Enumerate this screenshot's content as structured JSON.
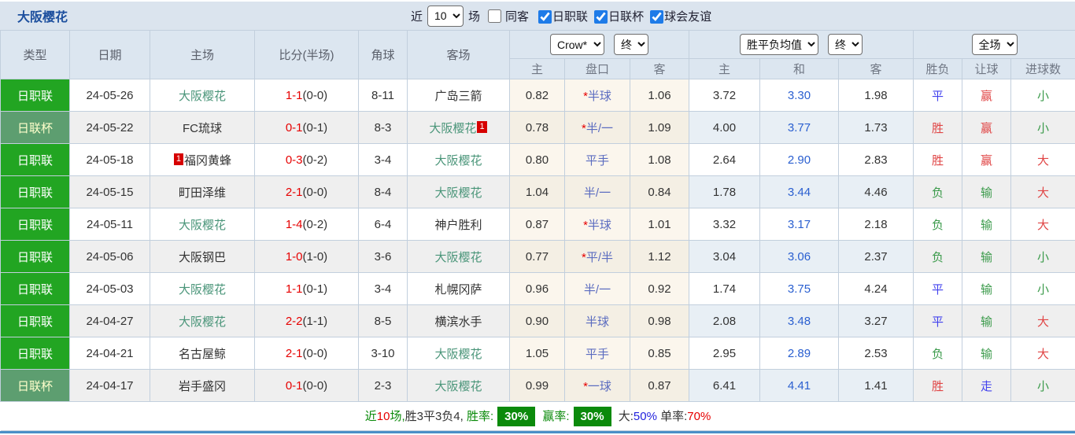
{
  "title": "大阪樱花",
  "topbar": {
    "recent_label": "近",
    "recent_value": "10",
    "matches_label": "场",
    "same_venue_label": "同客",
    "same_venue_checked": false,
    "filters": [
      {
        "label": "日职联",
        "checked": true
      },
      {
        "label": "日联杯",
        "checked": true
      },
      {
        "label": "球会友谊",
        "checked": true
      }
    ]
  },
  "header": {
    "cols": [
      "类型",
      "日期",
      "主场",
      "比分(半场)",
      "角球",
      "客场"
    ],
    "odds_select": "Crow*",
    "odds_time_select": "终",
    "odds_sub": [
      "主",
      "盘口",
      "客"
    ],
    "avg_select": "胜平负均值",
    "avg_time_select": "终",
    "avg_sub": [
      "主",
      "和",
      "客"
    ],
    "period_select": "全场",
    "result_sub": [
      "胜负",
      "让球",
      "进球数"
    ]
  },
  "colors": {
    "league_badge": "#22a522",
    "cup_badge": "#5d9e70",
    "self_team": "#4a9579",
    "score_red": "#e60000",
    "handicap_blue": "#5b6cc0",
    "avg_draw_blue": "#2a5fd0",
    "win_red": "#e04545",
    "draw_blue": "#4343ee",
    "lose_green": "#3a9a4a",
    "summary_box_green": "#0b8a0b",
    "bottom_line_blue": "#4a8fc7"
  },
  "rows": [
    {
      "league": "日职联",
      "cup": false,
      "date": "24-05-26",
      "home": {
        "name": "大阪樱花",
        "self": true,
        "badge": "",
        "badge_pos": ""
      },
      "score": "1-1",
      "half": "(0-0)",
      "corner": "8-11",
      "away": {
        "name": "广岛三箭",
        "self": false,
        "badge": "",
        "badge_pos": ""
      },
      "odds": {
        "home": "0.82",
        "star": true,
        "hcap": "半球",
        "away": "1.06"
      },
      "avg": [
        "3.72",
        "3.30",
        "1.98"
      ],
      "res": {
        "t": "平",
        "c": "blue"
      },
      "let": {
        "t": "赢",
        "c": "red"
      },
      "goal": {
        "t": "小",
        "c": "green"
      }
    },
    {
      "league": "日联杯",
      "cup": true,
      "date": "24-05-22",
      "home": {
        "name": "FC琉球",
        "self": false,
        "badge": "",
        "badge_pos": ""
      },
      "score": "0-1",
      "half": "(0-1)",
      "corner": "8-3",
      "away": {
        "name": "大阪樱花",
        "self": true,
        "badge": "1",
        "badge_pos": "post"
      },
      "odds": {
        "home": "0.78",
        "star": true,
        "hcap": "半/一",
        "away": "1.09"
      },
      "avg": [
        "4.00",
        "3.77",
        "1.73"
      ],
      "res": {
        "t": "胜",
        "c": "red"
      },
      "let": {
        "t": "赢",
        "c": "red"
      },
      "goal": {
        "t": "小",
        "c": "green"
      }
    },
    {
      "league": "日职联",
      "cup": false,
      "date": "24-05-18",
      "home": {
        "name": "福冈黄蜂",
        "self": false,
        "badge": "1",
        "badge_pos": "pre"
      },
      "score": "0-3",
      "half": "(0-2)",
      "corner": "3-4",
      "away": {
        "name": "大阪樱花",
        "self": true,
        "badge": "",
        "badge_pos": ""
      },
      "odds": {
        "home": "0.80",
        "star": false,
        "hcap": "平手",
        "away": "1.08"
      },
      "avg": [
        "2.64",
        "2.90",
        "2.83"
      ],
      "res": {
        "t": "胜",
        "c": "red"
      },
      "let": {
        "t": "赢",
        "c": "red"
      },
      "goal": {
        "t": "大",
        "c": "red"
      }
    },
    {
      "league": "日职联",
      "cup": false,
      "date": "24-05-15",
      "home": {
        "name": "町田泽维",
        "self": false,
        "badge": "",
        "badge_pos": ""
      },
      "score": "2-1",
      "half": "(0-0)",
      "corner": "8-4",
      "away": {
        "name": "大阪樱花",
        "self": true,
        "badge": "",
        "badge_pos": ""
      },
      "odds": {
        "home": "1.04",
        "star": false,
        "hcap": "半/一",
        "away": "0.84"
      },
      "avg": [
        "1.78",
        "3.44",
        "4.46"
      ],
      "res": {
        "t": "负",
        "c": "green"
      },
      "let": {
        "t": "输",
        "c": "green"
      },
      "goal": {
        "t": "大",
        "c": "red"
      }
    },
    {
      "league": "日职联",
      "cup": false,
      "date": "24-05-11",
      "home": {
        "name": "大阪樱花",
        "self": true,
        "badge": "",
        "badge_pos": ""
      },
      "score": "1-4",
      "half": "(0-2)",
      "corner": "6-4",
      "away": {
        "name": "神户胜利",
        "self": false,
        "badge": "",
        "badge_pos": ""
      },
      "odds": {
        "home": "0.87",
        "star": true,
        "hcap": "半球",
        "away": "1.01"
      },
      "avg": [
        "3.32",
        "3.17",
        "2.18"
      ],
      "res": {
        "t": "负",
        "c": "green"
      },
      "let": {
        "t": "输",
        "c": "green"
      },
      "goal": {
        "t": "大",
        "c": "red"
      }
    },
    {
      "league": "日职联",
      "cup": false,
      "date": "24-05-06",
      "home": {
        "name": "大阪钢巴",
        "self": false,
        "badge": "",
        "badge_pos": ""
      },
      "score": "1-0",
      "half": "(1-0)",
      "corner": "3-6",
      "away": {
        "name": "大阪樱花",
        "self": true,
        "badge": "",
        "badge_pos": ""
      },
      "odds": {
        "home": "0.77",
        "star": true,
        "hcap": "平/半",
        "away": "1.12"
      },
      "avg": [
        "3.04",
        "3.06",
        "2.37"
      ],
      "res": {
        "t": "负",
        "c": "green"
      },
      "let": {
        "t": "输",
        "c": "green"
      },
      "goal": {
        "t": "小",
        "c": "green"
      }
    },
    {
      "league": "日职联",
      "cup": false,
      "date": "24-05-03",
      "home": {
        "name": "大阪樱花",
        "self": true,
        "badge": "",
        "badge_pos": ""
      },
      "score": "1-1",
      "half": "(0-1)",
      "corner": "3-4",
      "away": {
        "name": "札幌冈萨",
        "self": false,
        "badge": "",
        "badge_pos": ""
      },
      "odds": {
        "home": "0.96",
        "star": false,
        "hcap": "半/一",
        "away": "0.92"
      },
      "avg": [
        "1.74",
        "3.75",
        "4.24"
      ],
      "res": {
        "t": "平",
        "c": "blue"
      },
      "let": {
        "t": "输",
        "c": "green"
      },
      "goal": {
        "t": "小",
        "c": "green"
      }
    },
    {
      "league": "日职联",
      "cup": false,
      "date": "24-04-27",
      "home": {
        "name": "大阪樱花",
        "self": true,
        "badge": "",
        "badge_pos": ""
      },
      "score": "2-2",
      "half": "(1-1)",
      "corner": "8-5",
      "away": {
        "name": "横滨水手",
        "self": false,
        "badge": "",
        "badge_pos": ""
      },
      "odds": {
        "home": "0.90",
        "star": false,
        "hcap": "半球",
        "away": "0.98"
      },
      "avg": [
        "2.08",
        "3.48",
        "3.27"
      ],
      "res": {
        "t": "平",
        "c": "blue"
      },
      "let": {
        "t": "输",
        "c": "green"
      },
      "goal": {
        "t": "大",
        "c": "red"
      }
    },
    {
      "league": "日职联",
      "cup": false,
      "date": "24-04-21",
      "home": {
        "name": "名古屋鲸",
        "self": false,
        "badge": "",
        "badge_pos": ""
      },
      "score": "2-1",
      "half": "(0-0)",
      "corner": "3-10",
      "away": {
        "name": "大阪樱花",
        "self": true,
        "badge": "",
        "badge_pos": ""
      },
      "odds": {
        "home": "1.05",
        "star": false,
        "hcap": "平手",
        "away": "0.85"
      },
      "avg": [
        "2.95",
        "2.89",
        "2.53"
      ],
      "res": {
        "t": "负",
        "c": "green"
      },
      "let": {
        "t": "输",
        "c": "green"
      },
      "goal": {
        "t": "大",
        "c": "red"
      }
    },
    {
      "league": "日联杯",
      "cup": true,
      "date": "24-04-17",
      "home": {
        "name": "岩手盛冈",
        "self": false,
        "badge": "",
        "badge_pos": ""
      },
      "score": "0-1",
      "half": "(0-0)",
      "corner": "2-3",
      "away": {
        "name": "大阪樱花",
        "self": true,
        "badge": "",
        "badge_pos": ""
      },
      "odds": {
        "home": "0.99",
        "star": true,
        "hcap": "一球",
        "away": "0.87"
      },
      "avg": [
        "6.41",
        "4.41",
        "1.41"
      ],
      "res": {
        "t": "胜",
        "c": "red"
      },
      "let": {
        "t": "走",
        "c": "blue"
      },
      "goal": {
        "t": "小",
        "c": "green"
      }
    }
  ],
  "summary": {
    "segments": [
      {
        "t": "近",
        "c": "green"
      },
      {
        "t": "10",
        "c": "red"
      },
      {
        "t": "场,",
        "c": "green"
      },
      {
        "t": "胜3平3负4, ",
        "c": "dark"
      },
      {
        "t": "胜率:",
        "c": "green"
      },
      {
        "t": "30%",
        "c": "box"
      },
      {
        "t": " 赢率:",
        "c": "green"
      },
      {
        "t": "30%",
        "c": "box"
      },
      {
        "t": " 大:",
        "c": "dark"
      },
      {
        "t": "50%",
        "c": "blue"
      },
      {
        "t": " 单率:",
        "c": "dark"
      },
      {
        "t": "70%",
        "c": "red"
      }
    ]
  }
}
